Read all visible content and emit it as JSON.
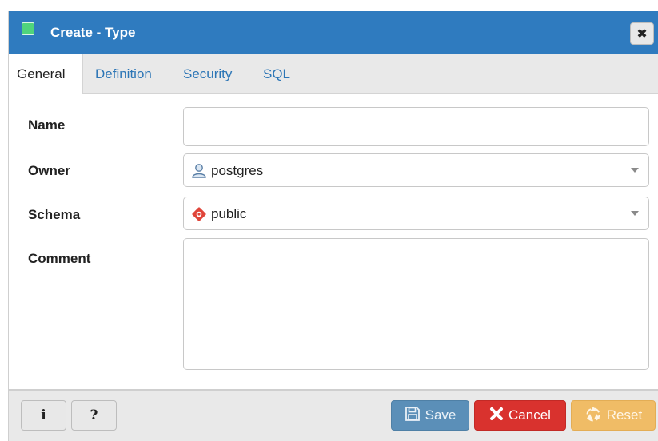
{
  "dialog": {
    "title": "Create - Type",
    "close_glyph": "✖"
  },
  "tabs": [
    {
      "label": "General",
      "active": true
    },
    {
      "label": "Definition",
      "active": false
    },
    {
      "label": "Security",
      "active": false
    },
    {
      "label": "SQL",
      "active": false
    }
  ],
  "form": {
    "name": {
      "label": "Name",
      "value": ""
    },
    "owner": {
      "label": "Owner",
      "value": "postgres",
      "icon": "user-icon"
    },
    "schema": {
      "label": "Schema",
      "value": "public",
      "icon": "schema-icon"
    },
    "comment": {
      "label": "Comment",
      "value": ""
    }
  },
  "footer": {
    "info_glyph": "i",
    "help_glyph": "?",
    "save_label": "Save",
    "cancel_label": "Cancel",
    "reset_label": "Reset"
  },
  "colors": {
    "titlebar": "#2f7bbf",
    "tab_link": "#2d76b6",
    "save": "#5b8fb8",
    "cancel": "#d9322e",
    "reset": "#f0bc66"
  }
}
